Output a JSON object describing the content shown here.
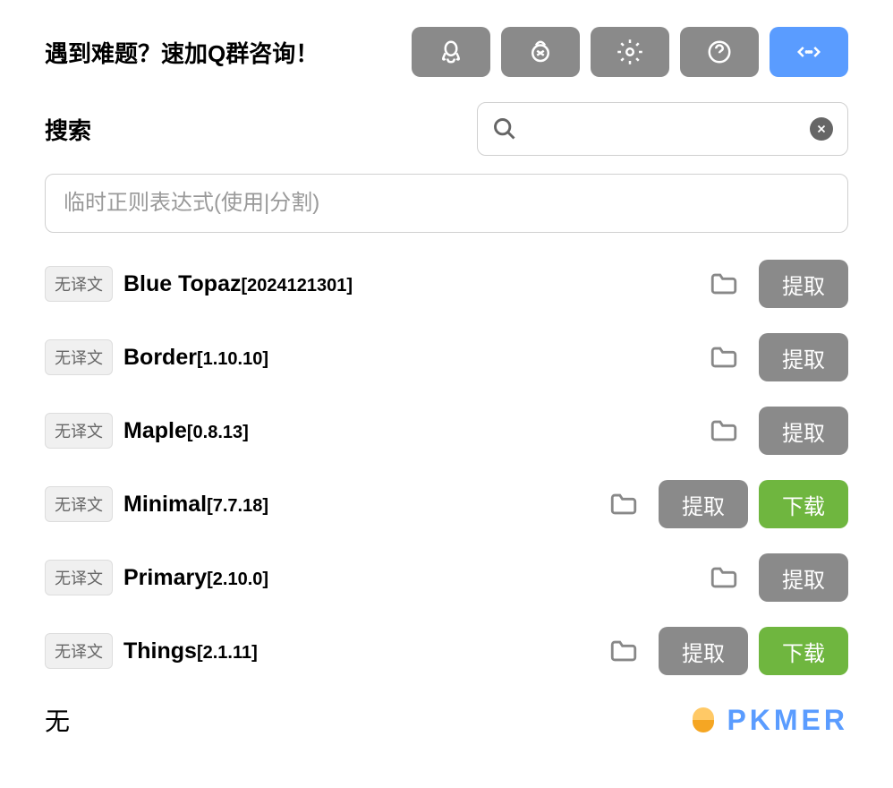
{
  "header": {
    "title": "遇到难题？速加Q群咨询！"
  },
  "search": {
    "label": "搜索",
    "placeholder": "",
    "regex_placeholder": "临时正则表达式(使用|分割)"
  },
  "badge_label": "无译文",
  "buttons": {
    "extract": "提取",
    "download": "下载"
  },
  "items": [
    {
      "name": "Blue Topaz",
      "version": "[2024121301]",
      "has_download": false
    },
    {
      "name": "Border",
      "version": "[1.10.10]",
      "has_download": false
    },
    {
      "name": "Maple",
      "version": "[0.8.13]",
      "has_download": false
    },
    {
      "name": "Minimal",
      "version": "[7.7.18]",
      "has_download": true
    },
    {
      "name": "Primary",
      "version": "[2.10.0]",
      "has_download": false
    },
    {
      "name": "Things",
      "version": "[2.1.11]",
      "has_download": true
    }
  ],
  "footer": {
    "text": "无",
    "logo": "PKMER"
  }
}
